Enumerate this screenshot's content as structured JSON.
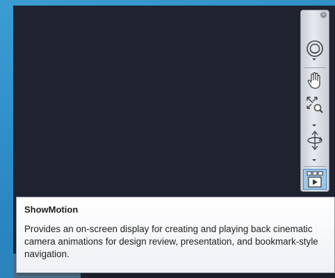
{
  "navigation_bar": {
    "tools": [
      {
        "name": "steering-wheel",
        "icon": "steering-wheel-icon",
        "has_dropdown": true
      },
      {
        "name": "pan",
        "icon": "hand-icon",
        "has_dropdown": false
      },
      {
        "name": "zoom-extents",
        "icon": "zoom-extents-icon",
        "has_dropdown": true
      },
      {
        "name": "orbit",
        "icon": "orbit-icon",
        "has_dropdown": true
      },
      {
        "name": "showmotion",
        "icon": "showmotion-icon",
        "active": true
      }
    ],
    "close_icon": "×"
  },
  "tooltip": {
    "title": "ShowMotion",
    "description": "Provides an on-screen display for creating and playing back cinematic camera animations for design review, presentation, and bookmark-style navigation."
  },
  "colors": {
    "background": "#2e8fc4",
    "viewport": "#1f2330",
    "tooltip_background": "#f7f8fa",
    "active_button": "#9ec7e8"
  }
}
